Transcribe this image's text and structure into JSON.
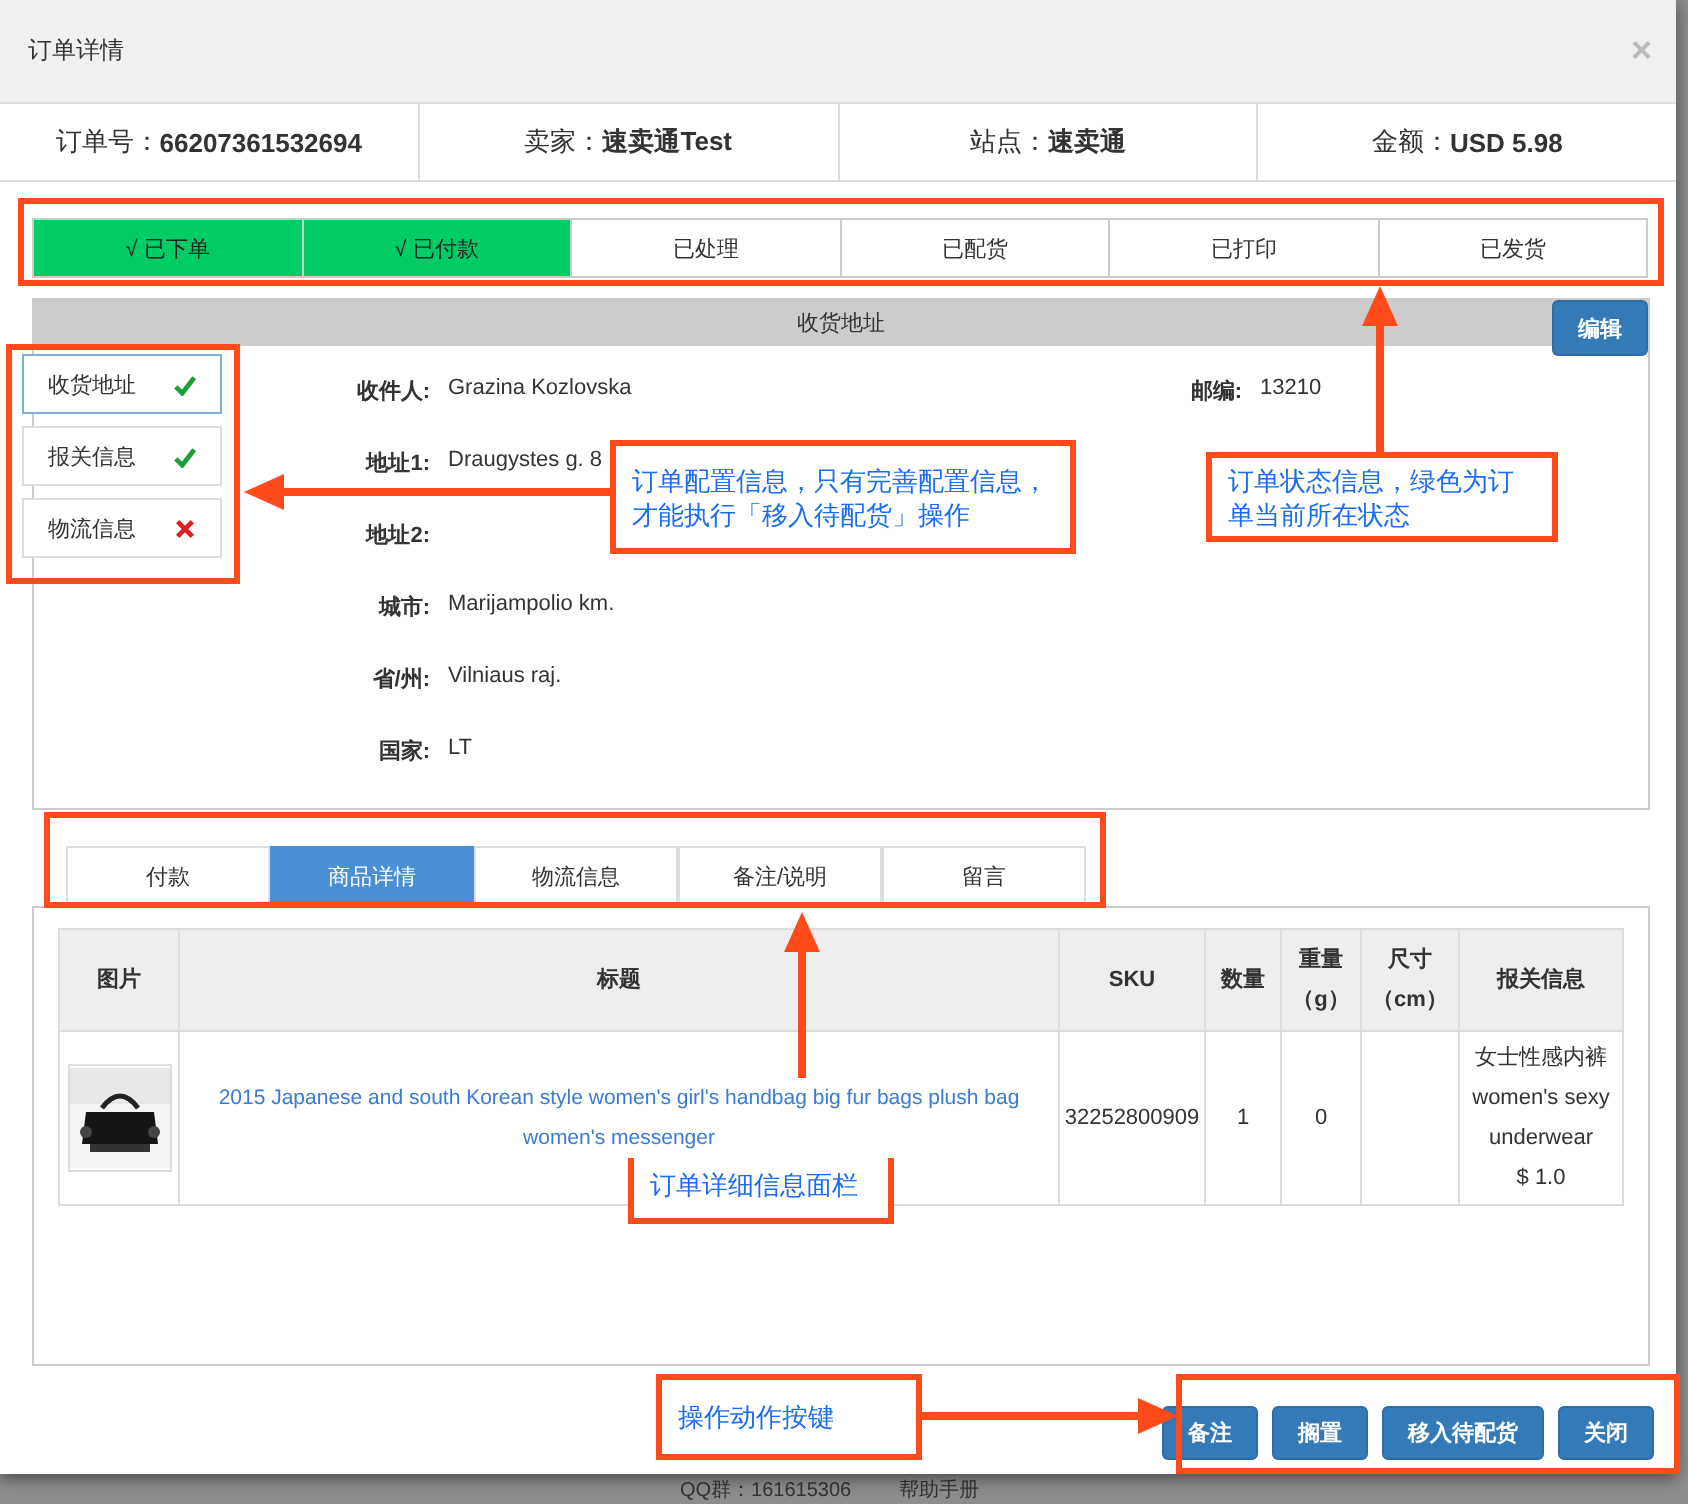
{
  "dialog": {
    "title": "订单详情",
    "close": "×"
  },
  "summary": [
    {
      "label": "订单号：",
      "value": "66207361532694"
    },
    {
      "label": "卖家：",
      "value": "速卖通Test"
    },
    {
      "label": "站点：",
      "value": "速卖通"
    },
    {
      "label": "金额：",
      "value": "USD 5.98"
    }
  ],
  "statuses": [
    {
      "label": "√ 已下单",
      "done": true
    },
    {
      "label": "√ 已付款",
      "done": true
    },
    {
      "label": "已处理",
      "done": false
    },
    {
      "label": "已配货",
      "done": false
    },
    {
      "label": "已打印",
      "done": false
    },
    {
      "label": "已发货",
      "done": false
    }
  ],
  "config_items": [
    {
      "label": "收货地址",
      "complete": true,
      "selected": true
    },
    {
      "label": "报关信息",
      "complete": true,
      "selected": false
    },
    {
      "label": "物流信息",
      "complete": false,
      "selected": false
    }
  ],
  "address": {
    "header": "收货地址",
    "edit_button": "编辑",
    "fields": [
      {
        "label": "收件人:",
        "value": "Grazina Kozlovska"
      },
      {
        "label": "地址1:",
        "value": "Draugystes g. 8"
      },
      {
        "label": "地址2:"
      },
      {
        "label": "城市:",
        "value": "Marijampolio km."
      },
      {
        "label": "省/州:",
        "value": "Vilniaus raj."
      },
      {
        "label": "国家:",
        "value": "LT"
      }
    ],
    "side_fields": [
      {
        "label": "邮编:",
        "value": "13210"
      }
    ]
  },
  "tabs": [
    {
      "label": "付款",
      "selected": false
    },
    {
      "label": "商品详情",
      "selected": true
    },
    {
      "label": "物流信息",
      "selected": false
    },
    {
      "label": "备注/说明",
      "selected": false
    },
    {
      "label": "留言",
      "selected": false
    }
  ],
  "table": {
    "columns": [
      "图片",
      "标题",
      "SKU",
      "数量",
      "重量（g）",
      "尺寸（cm）",
      "报关信息"
    ],
    "rows": [
      {
        "image": {
          "kind": "picture"
        },
        "title": "2015 Japanese and south Korean style women's girl's handbag big fur bags plush bag women's messenger",
        "sku": "32252800909",
        "quantity": "1",
        "weight": "0",
        "size": "",
        "customs": [
          "女士性感内裤",
          "women's sexy",
          "underwear",
          "$ 1.0"
        ]
      }
    ]
  },
  "buttons": [
    "备注",
    "搁置",
    "移入待配货",
    "关闭"
  ],
  "footer": [
    "QQ群：161615306",
    "帮助手册"
  ],
  "annotations": [
    "订单配置信息，只有完善配置信息，才能执行「移入待配货」操作",
    "订单状态信息，绿色为订单当前所在状态",
    "订单详细信息面栏",
    "操作动作按键"
  ]
}
